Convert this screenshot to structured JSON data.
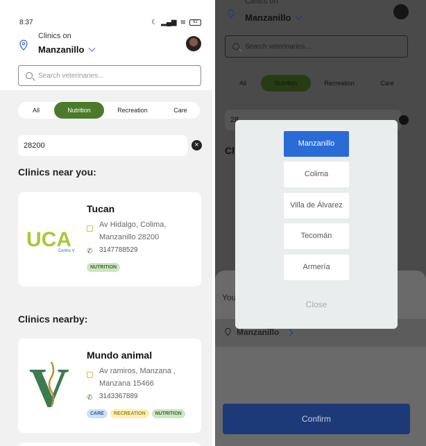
{
  "status": {
    "time": "8:37",
    "battery": "92"
  },
  "header": {
    "clinics_on": "Clinics on",
    "city": "Manzanillo"
  },
  "search": {
    "placeholder": "Search veterinaries..."
  },
  "tabs": [
    {
      "label": "All",
      "active": false
    },
    {
      "label": "Nutrition",
      "active": true
    },
    {
      "label": "Recreation",
      "active": false
    },
    {
      "label": "Care",
      "active": false
    }
  ],
  "zip": {
    "value": "28200"
  },
  "sections": {
    "near": "Clinics near you:",
    "nearby": "Clinics nearby:"
  },
  "clinics": [
    {
      "name": "Tucan",
      "address": "Av Hidalgo, Colima, Manzanillo 28200",
      "phone": "3147788529",
      "logo_text": "UCA",
      "logo_sub": "Centro V",
      "tags": [
        "NUTRITION"
      ]
    },
    {
      "name": "Mundo animal",
      "address": "Av ramiros, Manzana , Manzana  15466",
      "phone": "3143367889",
      "logo_text": "V",
      "tags": [
        "CARE",
        "RECREATION",
        "NUTRITION"
      ]
    }
  ],
  "modal": {
    "options": [
      "Manzanillo",
      "Colima",
      "Villa de Álvarez",
      "Tecomán",
      "Armería"
    ],
    "selected": "Manzanillo",
    "close_label": "Close"
  },
  "sheet": {
    "heading_partial": "You",
    "location": "Manzanillo",
    "confirm_label": "Confirm"
  },
  "background": {
    "zip_partial": "28",
    "section_partial": "Cli"
  },
  "colors": {
    "primary_green": "#4a7a2a",
    "primary_blue": "#2a6bd6",
    "confirm_blue": "#1c3a78"
  }
}
